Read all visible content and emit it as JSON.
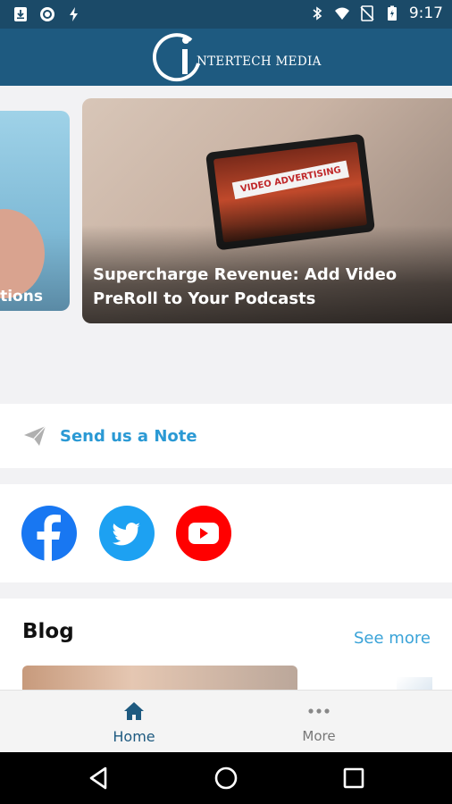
{
  "status_bar": {
    "time": "9:17",
    "left_icons": [
      "download-icon",
      "record-icon",
      "flash-icon"
    ],
    "right_icons": [
      "bluetooth-icon",
      "wifi-icon",
      "no-sim-icon",
      "battery-icon"
    ]
  },
  "app_bar": {
    "logo_letter": "i",
    "brand": "NTERTECH MEDIA"
  },
  "carousel": {
    "cards": [
      {
        "caption": "ctions"
      },
      {
        "caption": "Supercharge Revenue: Add Video PreRoll to Your Podcasts",
        "image_text": "VIDEO ADVERTISING"
      }
    ]
  },
  "note": {
    "label": "Send us a Note",
    "icon": "paper-plane-icon"
  },
  "social": {
    "links": [
      {
        "name": "facebook",
        "color": "#1877f2"
      },
      {
        "name": "twitter",
        "color": "#1da1f2"
      },
      {
        "name": "youtube",
        "color": "#ff0000"
      }
    ]
  },
  "blog": {
    "title": "Blog",
    "see_more": "See more"
  },
  "bottom_nav": {
    "tabs": [
      {
        "label": "Home",
        "icon": "home-icon",
        "active": true
      },
      {
        "label": "More",
        "icon": "more-dots-icon",
        "active": false
      }
    ]
  },
  "colors": {
    "status_bar": "#1b4a68",
    "app_bar": "#1e5a80",
    "accent": "#2a99d4"
  }
}
